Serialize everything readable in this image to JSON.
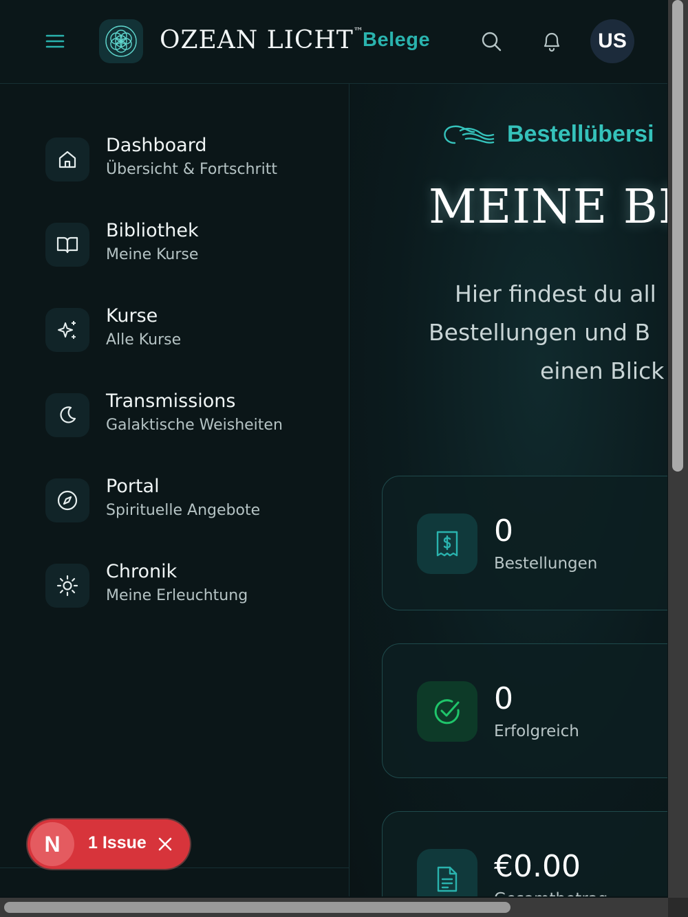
{
  "header": {
    "brand_name": "OZEAN LICHT",
    "brand_tm": "™",
    "page_label": "Belege",
    "avatar_initials": "US",
    "icons": [
      "menu-icon",
      "flower-of-life-logo",
      "search-icon",
      "bell-icon"
    ]
  },
  "sidebar": {
    "items": [
      {
        "title": "Dashboard",
        "subtitle": "Übersicht & Fortschritt",
        "icon": "home-icon"
      },
      {
        "title": "Bibliothek",
        "subtitle": "Meine Kurse",
        "icon": "book-open-icon"
      },
      {
        "title": "Kurse",
        "subtitle": "Alle Kurse",
        "icon": "sparkles-icon"
      },
      {
        "title": "Transmissions",
        "subtitle": "Galaktische Weisheiten",
        "icon": "moon-icon"
      },
      {
        "title": "Portal",
        "subtitle": "Spirituelle Angebote",
        "icon": "compass-icon"
      },
      {
        "title": "Chronik",
        "subtitle": "Meine Erleuchtung",
        "icon": "sun-icon"
      }
    ]
  },
  "issue_badge": {
    "letter": "N",
    "text": "1 Issue"
  },
  "main": {
    "eyebrow": "Bestellübersi",
    "title": "MEINE BE",
    "intro_lines": [
      "Hier findest du all",
      "Bestellungen und B",
      "einen Blick"
    ],
    "stats": [
      {
        "value": "0",
        "label": "Bestellungen",
        "icon": "receipt-icon"
      },
      {
        "value": "0",
        "label": "Erfolgreich",
        "icon": "check-circle-icon"
      },
      {
        "value": "€0.00",
        "label": "Gesamtbetrag",
        "icon": "document-icon"
      }
    ]
  },
  "colors": {
    "accent": "#2ab3ae",
    "success": "#1fc46a",
    "issue_red": "#d7343b",
    "background": "#0a1416"
  }
}
